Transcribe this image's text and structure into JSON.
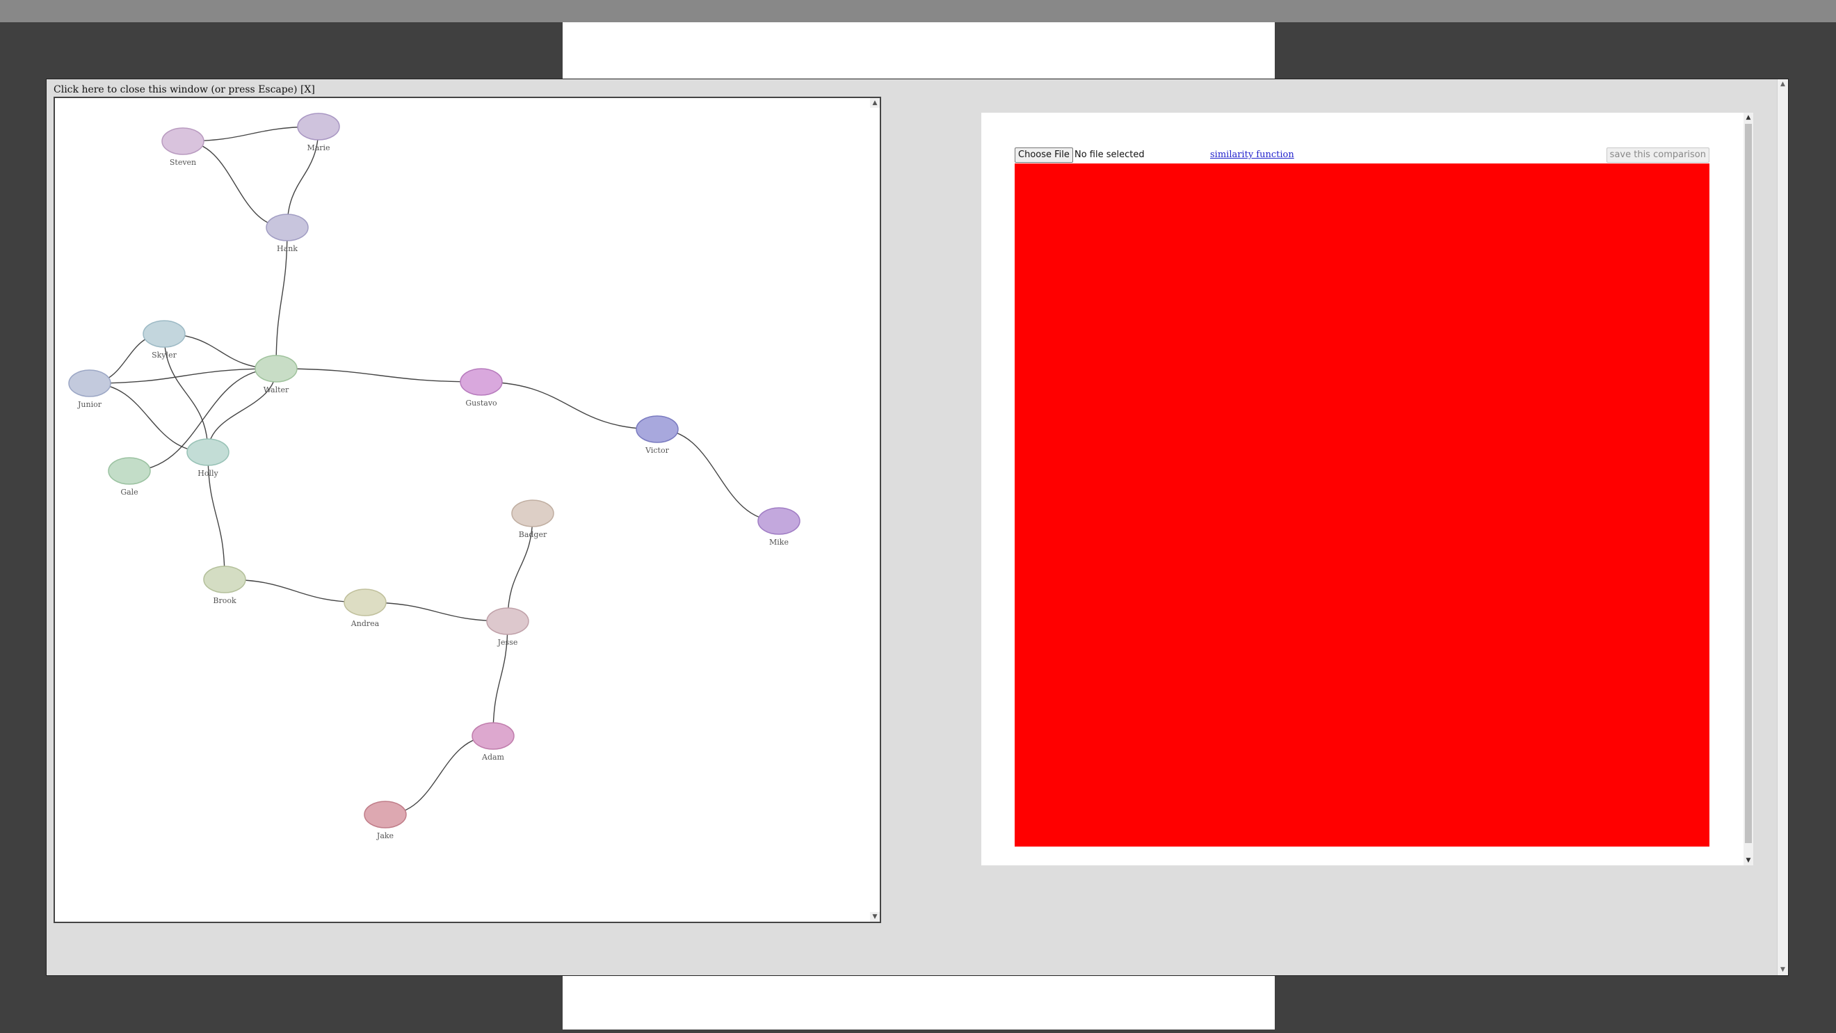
{
  "overlay": {
    "close_text": "Click here to close this window (or press Escape) [X]"
  },
  "graph": {
    "nodes": [
      {
        "id": "steven",
        "label": "Steven",
        "color": "#d9c3dd",
        "stroke": "#b99bc0"
      },
      {
        "id": "marie",
        "label": "Marie",
        "color": "#cfc3dd",
        "stroke": "#a997c3"
      },
      {
        "id": "hank",
        "label": "Hank",
        "color": "#c8c5dd",
        "stroke": "#a19dc3"
      },
      {
        "id": "skyler",
        "label": "Skyler",
        "color": "#c3d6dd",
        "stroke": "#9dbac5"
      },
      {
        "id": "junior",
        "label": "Junior",
        "color": "#c3cadd",
        "stroke": "#9ca7c5"
      },
      {
        "id": "walter",
        "label": "Walter",
        "color": "#c8ddc6",
        "stroke": "#9fc29c"
      },
      {
        "id": "gustavo",
        "label": "Gustavo",
        "color": "#d9a8dd",
        "stroke": "#b77bbd"
      },
      {
        "id": "victor",
        "label": "Victor",
        "color": "#a8a8dd",
        "stroke": "#7a7bc0"
      },
      {
        "id": "mike",
        "label": "Mike",
        "color": "#c3a8dd",
        "stroke": "#a07dc4"
      },
      {
        "id": "holly",
        "label": "Holly",
        "color": "#c3ddd6",
        "stroke": "#98c2b6"
      },
      {
        "id": "gale",
        "label": "Gale",
        "color": "#c3ddc8",
        "stroke": "#9bc2a1"
      },
      {
        "id": "badger",
        "label": "Badger",
        "color": "#ddcfc6",
        "stroke": "#c0aea1"
      },
      {
        "id": "brook",
        "label": "Brook",
        "color": "#d4ddc3",
        "stroke": "#b4c09b"
      },
      {
        "id": "andrea",
        "label": "Andrea",
        "color": "#ddddc3",
        "stroke": "#c0c09c"
      },
      {
        "id": "jesse",
        "label": "Jesse",
        "color": "#ddc8cd",
        "stroke": "#c0a1a9"
      },
      {
        "id": "adam",
        "label": "Adam",
        "color": "#dda8cf",
        "stroke": "#c07dac"
      },
      {
        "id": "jake",
        "label": "Jake",
        "color": "#dda8b1",
        "stroke": "#c07d89"
      }
    ],
    "edge_color": "#444444"
  },
  "compare": {
    "choose_file_label": "Choose File",
    "file_status": "No file selected",
    "similarity_link": "similarity function",
    "save_label": "save this comparison",
    "canvas_color": "#ff0000"
  }
}
